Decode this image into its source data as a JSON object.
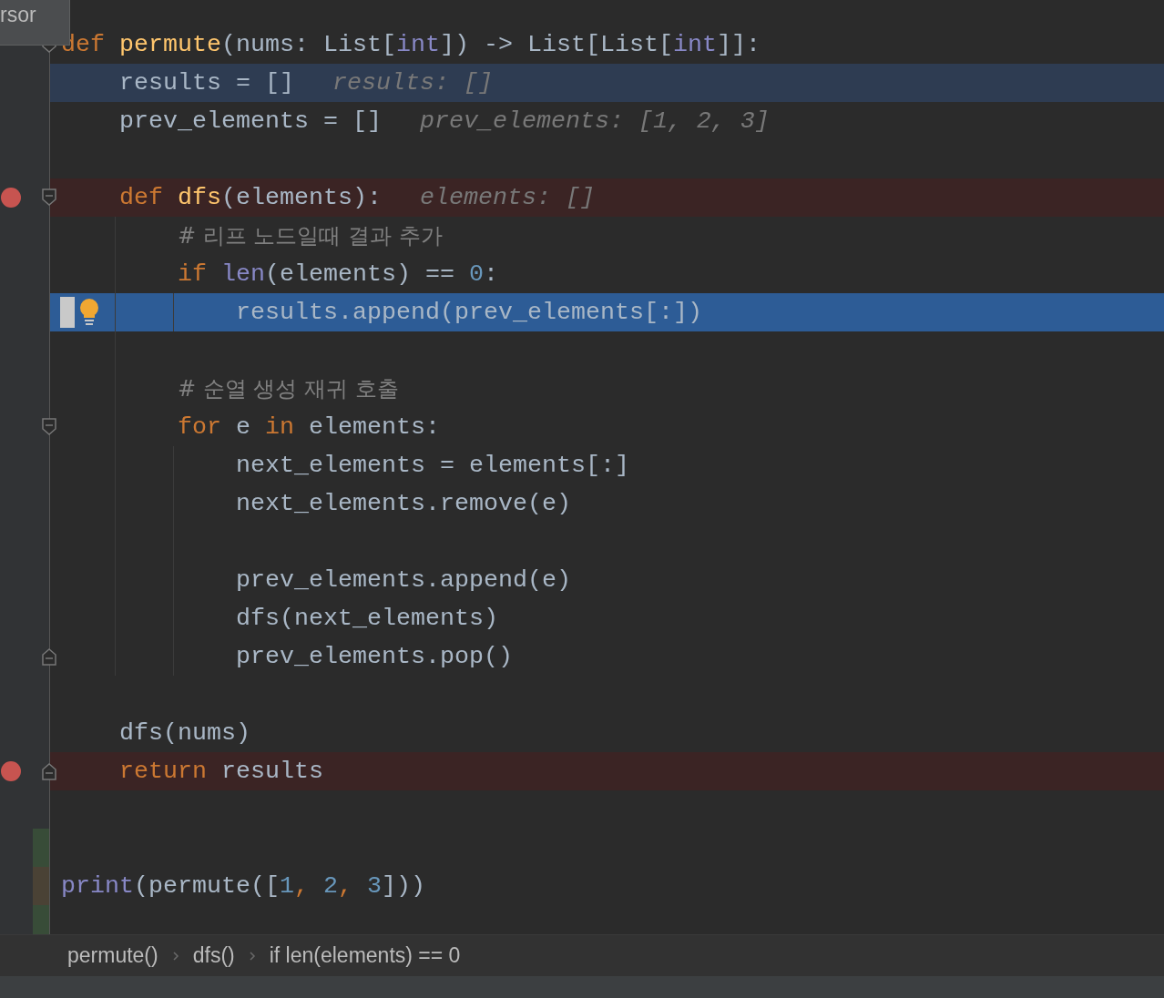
{
  "tooltip": {
    "text": "rsor"
  },
  "code": [
    {
      "kind": "code",
      "tokens": [
        {
          "kind": "keyword",
          "text": "def "
        },
        {
          "kind": "function",
          "text": "permute"
        },
        {
          "kind": "plain",
          "text": "(nums: List["
        },
        {
          "kind": "builtin",
          "text": "int"
        },
        {
          "kind": "plain",
          "text": "]) -> List[List["
        },
        {
          "kind": "builtin",
          "text": "int"
        },
        {
          "kind": "plain",
          "text": "]]:"
        }
      ],
      "children": [
        {
          "kind": "current_line",
          "tokens": [
            {
              "kind": "plain",
              "text": "results = []"
            },
            {
              "kind": "hint",
              "text": "results: []"
            }
          ]
        },
        {
          "kind": "code",
          "tokens": [
            {
              "kind": "plain",
              "text": "prev_elements = []"
            },
            {
              "kind": "hint",
              "text": "prev_elements: [1, 2, 3]"
            }
          ]
        },
        {
          "kind": "blank"
        },
        {
          "kind": "breakpoint",
          "tokens": [
            {
              "kind": "keyword",
              "text": "def "
            },
            {
              "kind": "function",
              "text": "dfs"
            },
            {
              "kind": "plain",
              "text": "(elements):"
            },
            {
              "kind": "hint",
              "text": "elements: []"
            }
          ],
          "children": [
            {
              "kind": "code",
              "tokens": [
                {
                  "kind": "comment",
                  "text": "# 리프 노드일때 결과 추가"
                }
              ]
            },
            {
              "kind": "code",
              "tokens": [
                {
                  "kind": "keyword",
                  "text": "if "
                },
                {
                  "kind": "builtin",
                  "text": "len"
                },
                {
                  "kind": "plain",
                  "text": "(elements) == "
                },
                {
                  "kind": "number",
                  "text": "0"
                },
                {
                  "kind": "plain",
                  "text": ":"
                }
              ],
              "children": [
                {
                  "kind": "execution_point",
                  "tokens": [
                    {
                      "kind": "plain",
                      "text": "results.append(prev_elements[:])"
                    }
                  ]
                }
              ]
            },
            {
              "kind": "blank"
            },
            {
              "kind": "code",
              "tokens": [
                {
                  "kind": "comment",
                  "text": "# 순열 생성 재귀 호출"
                }
              ]
            },
            {
              "kind": "code",
              "tokens": [
                {
                  "kind": "keyword",
                  "text": "for "
                },
                {
                  "kind": "plain",
                  "text": "e "
                },
                {
                  "kind": "keyword",
                  "text": "in "
                },
                {
                  "kind": "plain",
                  "text": "elements:"
                }
              ],
              "children": [
                {
                  "kind": "code",
                  "tokens": [
                    {
                      "kind": "plain",
                      "text": "next_elements = elements[:]"
                    }
                  ]
                },
                {
                  "kind": "code",
                  "tokens": [
                    {
                      "kind": "plain",
                      "text": "next_elements.remove(e)"
                    }
                  ]
                },
                {
                  "kind": "blank"
                },
                {
                  "kind": "code",
                  "tokens": [
                    {
                      "kind": "plain",
                      "text": "prev_elements.append(e)"
                    }
                  ]
                },
                {
                  "kind": "code",
                  "tokens": [
                    {
                      "kind": "plain",
                      "text": "dfs(next_elements)"
                    }
                  ]
                },
                {
                  "kind": "code",
                  "tokens": [
                    {
                      "kind": "plain",
                      "text": "prev_elements.pop()"
                    }
                  ]
                }
              ]
            }
          ]
        },
        {
          "kind": "blank"
        },
        {
          "kind": "code",
          "tokens": [
            {
              "kind": "plain",
              "text": "dfs(nums)"
            }
          ]
        },
        {
          "kind": "breakpoint",
          "tokens": [
            {
              "kind": "keyword",
              "text": "return "
            },
            {
              "kind": "plain",
              "text": "results"
            }
          ]
        }
      ]
    },
    {
      "kind": "blank"
    },
    {
      "kind": "blank",
      "added": true
    },
    {
      "kind": "code",
      "modified": true,
      "tokens": [
        {
          "kind": "builtin",
          "text": "print"
        },
        {
          "kind": "plain",
          "text": "(permute(["
        },
        {
          "kind": "number",
          "text": "1"
        },
        {
          "kind": "keyword",
          "text": ", "
        },
        {
          "kind": "number",
          "text": "2"
        },
        {
          "kind": "keyword",
          "text": ", "
        },
        {
          "kind": "number",
          "text": "3"
        },
        {
          "kind": "plain",
          "text": "]))"
        }
      ]
    },
    {
      "kind": "blank",
      "added": true
    }
  ],
  "breadcrumbs": [
    {
      "label": "permute()"
    },
    {
      "label": "dfs()"
    },
    {
      "label": "if len(elements) == 0"
    }
  ]
}
